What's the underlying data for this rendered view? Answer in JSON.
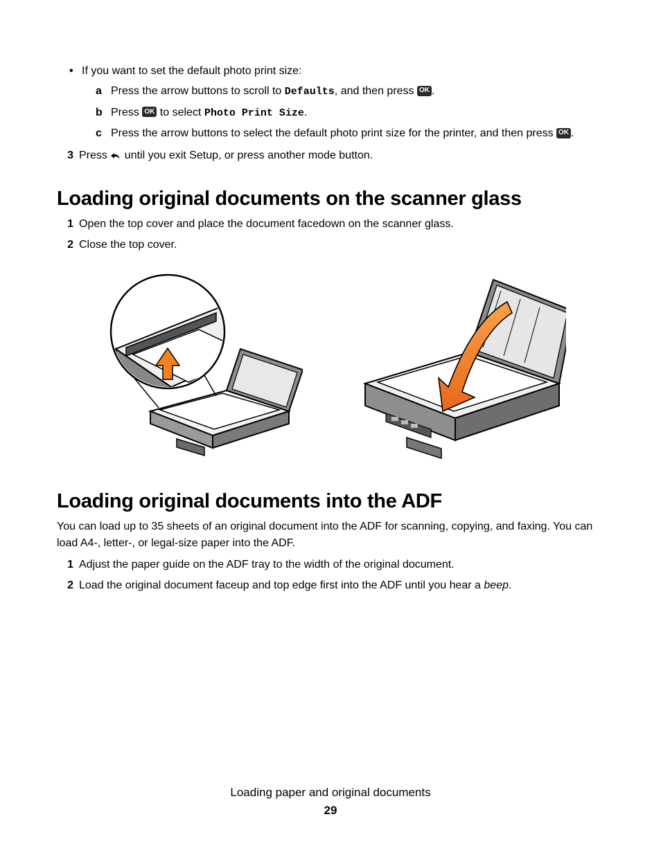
{
  "intro": {
    "bullet_lead": "If you want to set the default photo print size:",
    "a_pre": "Press the arrow buttons to scroll to ",
    "a_mono": "Defaults",
    "a_mid": ", and then press ",
    "a_post": ".",
    "b_pre": "Press ",
    "b_mid": " to select ",
    "b_mono": "Photo Print Size",
    "b_post": ".",
    "c_pre": "Press the arrow buttons to select the default photo print size for the printer, and then press ",
    "c_post": "."
  },
  "step3_pre": "Press ",
  "step3_post": " until you exit Setup, or press another mode button.",
  "ok_label": "OK",
  "section_scanner": {
    "heading": "Loading original documents on the scanner glass",
    "step1": "Open the top cover and place the document facedown on the scanner glass.",
    "step2": "Close the top cover."
  },
  "section_adf": {
    "heading": "Loading original documents into the ADF",
    "para": "You can load up to 35 sheets of an original document into the ADF for scanning, copying, and faxing. You can load A4-, letter-, or legal-size paper into the ADF.",
    "step1": "Adjust the paper guide on the ADF tray to the width of the original document.",
    "step2_pre": "Load the original document faceup and top edge first into the ADF until you hear a ",
    "step2_italic": "beep",
    "step2_post": "."
  },
  "footer": {
    "title": "Loading paper and original documents",
    "page": "29"
  },
  "labels": {
    "a": "a",
    "b": "b",
    "c": "c",
    "n1": "1",
    "n2": "2",
    "n3": "3"
  }
}
